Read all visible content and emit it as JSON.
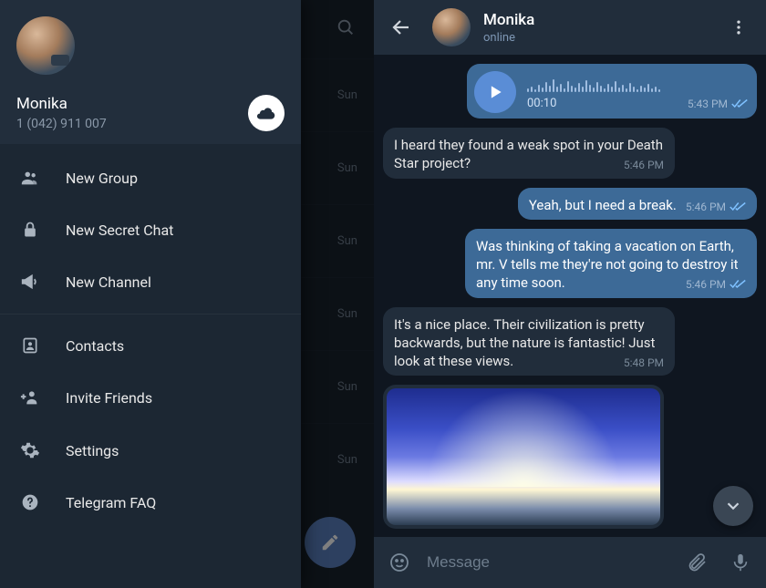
{
  "drawer": {
    "name": "Monika",
    "phone": "1 (042) 911 007",
    "items": [
      {
        "label": "New Group",
        "icon": "group-icon"
      },
      {
        "label": "New Secret Chat",
        "icon": "lock-icon"
      },
      {
        "label": "New Channel",
        "icon": "megaphone-icon"
      },
      {
        "label": "Contacts",
        "icon": "contact-icon"
      },
      {
        "label": "Invite Friends",
        "icon": "invite-icon"
      },
      {
        "label": "Settings",
        "icon": "gear-icon"
      },
      {
        "label": "Telegram FAQ",
        "icon": "help-icon"
      }
    ]
  },
  "chatlist_bg": {
    "date_hint": "Sun"
  },
  "chat": {
    "header": {
      "name": "Monika",
      "status": "online"
    },
    "composer_placeholder": "Message",
    "messages": [
      {
        "type": "voice",
        "direction": "out",
        "duration": "00:10",
        "time": "5:43 PM",
        "read": true
      },
      {
        "type": "text",
        "direction": "in",
        "text": "I heard they found a weak spot in your Death Star project?",
        "time": "5:46 PM"
      },
      {
        "type": "text",
        "direction": "out",
        "text": "Yeah, but I need a break.",
        "time": "5:46 PM",
        "read": true
      },
      {
        "type": "text",
        "direction": "out",
        "text": "Was thinking of taking a vacation on Earth, mr. V tells me they're not going to destroy it any time soon.",
        "time": "5:46 PM",
        "read": true
      },
      {
        "type": "text",
        "direction": "in",
        "text": "It's a nice place. Their civilization is pretty backwards, but the nature is fantastic! Just look at these views.",
        "time": "5:48 PM"
      },
      {
        "type": "photo",
        "direction": "in"
      }
    ]
  },
  "colors": {
    "out_bubble": "#3d6a97",
    "in_bubble": "#212d3b",
    "accent": "#5a8dd6"
  }
}
